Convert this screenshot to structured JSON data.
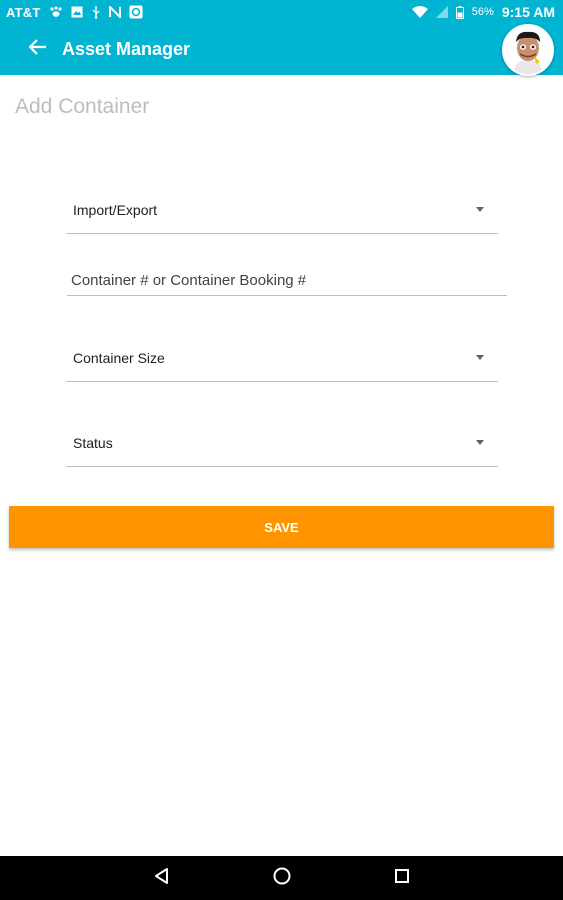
{
  "status_bar": {
    "carrier": "AT&T",
    "battery_percent": "56%",
    "time": "9:15 AM",
    "icons": [
      "paw-icon",
      "image-icon",
      "usb-icon",
      "n-icon",
      "app-icon",
      "wifi-icon",
      "signal-icon",
      "battery-icon"
    ]
  },
  "app_bar": {
    "title": "Asset Manager",
    "back_icon": "arrow-left-icon",
    "avatar": "user-avatar"
  },
  "page": {
    "heading": "Add Container"
  },
  "form": {
    "import_export": {
      "label": "Import/Export",
      "icon": "dropdown-arrow-icon"
    },
    "container_number": {
      "placeholder": "Container # or Container Booking #"
    },
    "container_size": {
      "label": "Container Size",
      "icon": "dropdown-arrow-icon"
    },
    "status": {
      "label": "Status",
      "icon": "dropdown-arrow-icon"
    },
    "save_label": "SAVE"
  },
  "nav_bar": {
    "icons": [
      "back-triangle-icon",
      "home-circle-icon",
      "recents-square-icon"
    ]
  },
  "colors": {
    "primary": "#00B4D2",
    "accent": "#FF9400",
    "heading_gray": "#BDBDBD"
  }
}
